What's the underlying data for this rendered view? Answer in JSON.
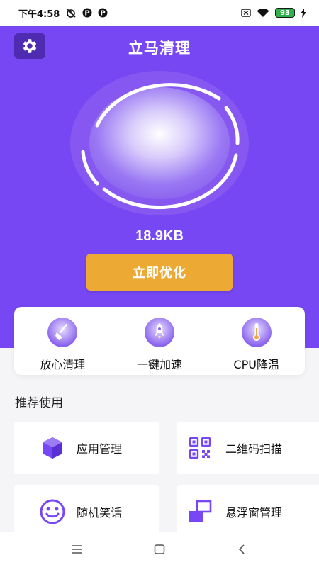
{
  "status_bar": {
    "time": "下午4:58",
    "battery": "93"
  },
  "header": {
    "title": "立马清理",
    "settings_icon": "gear-icon"
  },
  "scan": {
    "size": "18.9KB",
    "optimize_label": "立即优化"
  },
  "features": [
    {
      "label": "放心清理",
      "icon": "broom-icon"
    },
    {
      "label": "一键加速",
      "icon": "rocket-icon"
    },
    {
      "label": "CPU降温",
      "icon": "thermometer-icon"
    }
  ],
  "recommended": {
    "title": "推荐使用",
    "tools": [
      {
        "label": "应用管理",
        "icon": "cube-icon"
      },
      {
        "label": "二维码扫描",
        "icon": "qr-code-icon"
      },
      {
        "label": "随机笑话",
        "icon": "smiley-icon"
      },
      {
        "label": "悬浮窗管理",
        "icon": "floating-window-icon"
      }
    ]
  },
  "colors": {
    "primary": "#7647f2",
    "settings_bg": "#4e2bb0",
    "accent_button": "#ecaa35",
    "battery": "#2fb24c"
  }
}
